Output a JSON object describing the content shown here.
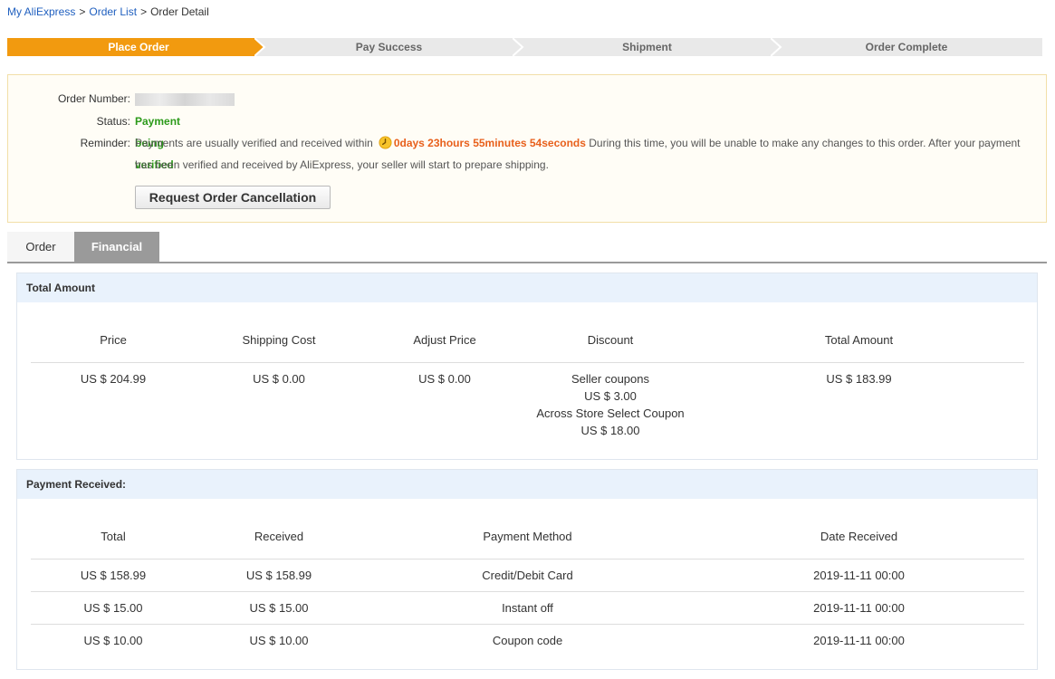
{
  "breadcrumb": {
    "items": [
      "My AliExpress",
      "Order List",
      "Order Detail"
    ],
    "separator": ">"
  },
  "steps": [
    {
      "label": "Place Order",
      "active": true
    },
    {
      "label": "Pay Success",
      "active": false
    },
    {
      "label": "Shipment",
      "active": false
    },
    {
      "label": "Order Complete",
      "active": false
    }
  ],
  "order_info": {
    "order_number_label": "Order Number:",
    "status_label": "Status:",
    "status_value": "Payment being verified",
    "reminder_label": "Reminder:",
    "reminder_text_before": "Payments are usually verified and received within",
    "countdown": "0days 23hours 55minutes 54seconds",
    "reminder_text_after": "During this time, you will be unable to make any changes to this order. After your payment",
    "reminder_text_line2": "has been verified and received by AliExpress, your seller will start to prepare shipping.",
    "cancel_button": "Request Order Cancellation"
  },
  "tabs": [
    {
      "label": "Order",
      "active": false
    },
    {
      "label": "Financial",
      "active": true
    }
  ],
  "total_amount": {
    "title": "Total Amount",
    "headers": [
      "Price",
      "Shipping Cost",
      "Adjust Price",
      "Discount",
      "Total Amount"
    ],
    "price": "US $ 204.99",
    "shipping_cost": "US $ 0.00",
    "adjust_price": "US $ 0.00",
    "discount_lines": [
      "Seller coupons",
      "US $ 3.00",
      "Across Store Select Coupon",
      "US $ 18.00"
    ],
    "total": "US $ 183.99"
  },
  "payment_received": {
    "title": "Payment Received:",
    "headers": [
      "Total",
      "Received",
      "Payment Method",
      "Date Received"
    ],
    "rows": [
      [
        "US $ 158.99",
        "US $ 158.99",
        "Credit/Debit Card",
        "2019-11-11 00:00"
      ],
      [
        "US $ 15.00",
        "US $ 15.00",
        "Instant off",
        "2019-11-11 00:00"
      ],
      [
        "US $ 10.00",
        "US $ 10.00",
        "Coupon code",
        "2019-11-11 00:00"
      ]
    ]
  },
  "colors": {
    "step_active": "#f29a0f",
    "step_inactive": "#e9e9e9",
    "status_green": "#2c9a1a",
    "countdown_orange": "#e8601c",
    "link_blue": "#1f5fbf",
    "panel_header_bg": "#e9f2fc"
  },
  "icons": {
    "countdown": "clock-icon"
  }
}
